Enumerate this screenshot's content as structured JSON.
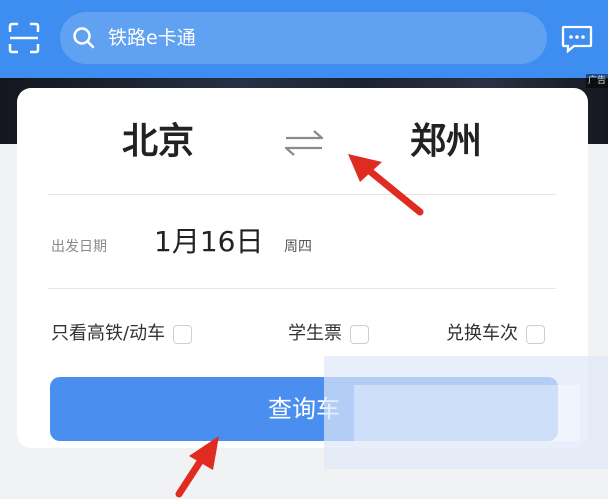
{
  "header": {
    "search_placeholder": "铁路e卡通",
    "background_color": "#3e8df0",
    "icons": {
      "scan": "scan-icon",
      "search": "search-icon",
      "messages": "message-icon"
    }
  },
  "banner": {
    "ad_tag": "广告"
  },
  "route": {
    "from_city": "北京",
    "to_city": "郑州",
    "swap_icon": "swap-arrows-icon"
  },
  "date": {
    "label": "出发日期",
    "value": "1月16日",
    "weekday": "周四"
  },
  "options": [
    {
      "label": "只看高铁/动车",
      "checked": false
    },
    {
      "label": "学生票",
      "checked": false
    },
    {
      "label": "兑换车次",
      "checked": false
    }
  ],
  "query_button": {
    "label": "查询车",
    "color": "#4a8ff0"
  },
  "annotations": {
    "arrow_color": "#e02b20"
  }
}
